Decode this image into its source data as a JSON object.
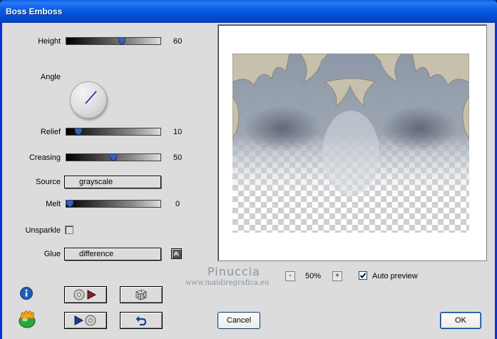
{
  "window": {
    "title": "Boss Emboss"
  },
  "controls": {
    "height": {
      "label": "Height",
      "value": "60",
      "level": 0.6
    },
    "angle": {
      "label": "Angle"
    },
    "relief": {
      "label": "Relief",
      "value": "10",
      "level": 0.1
    },
    "creasing": {
      "label": "Creasing",
      "value": "50",
      "level": 0.5
    },
    "source": {
      "label": "Source",
      "value": "grayscale"
    },
    "melt": {
      "label": "Melt",
      "value": "0",
      "level": 0
    },
    "unsparkle": {
      "label": "Unsparkle",
      "checked": false
    },
    "glue": {
      "label": "Glue",
      "value": "difference"
    }
  },
  "watermark": {
    "line1": "Pinuccia",
    "line2": "www.maidiregrafica.eu"
  },
  "zoom": {
    "minus": "-",
    "value": "50%",
    "plus": "+"
  },
  "auto_preview": {
    "label": "Auto preview",
    "checked": true
  },
  "buttons": {
    "cancel": "Cancel",
    "ok": "OK"
  },
  "colors": {
    "slider_thumb": "#3b5fb0",
    "angle_line": "#1a1ab0",
    "info": "#1e5fb4"
  }
}
